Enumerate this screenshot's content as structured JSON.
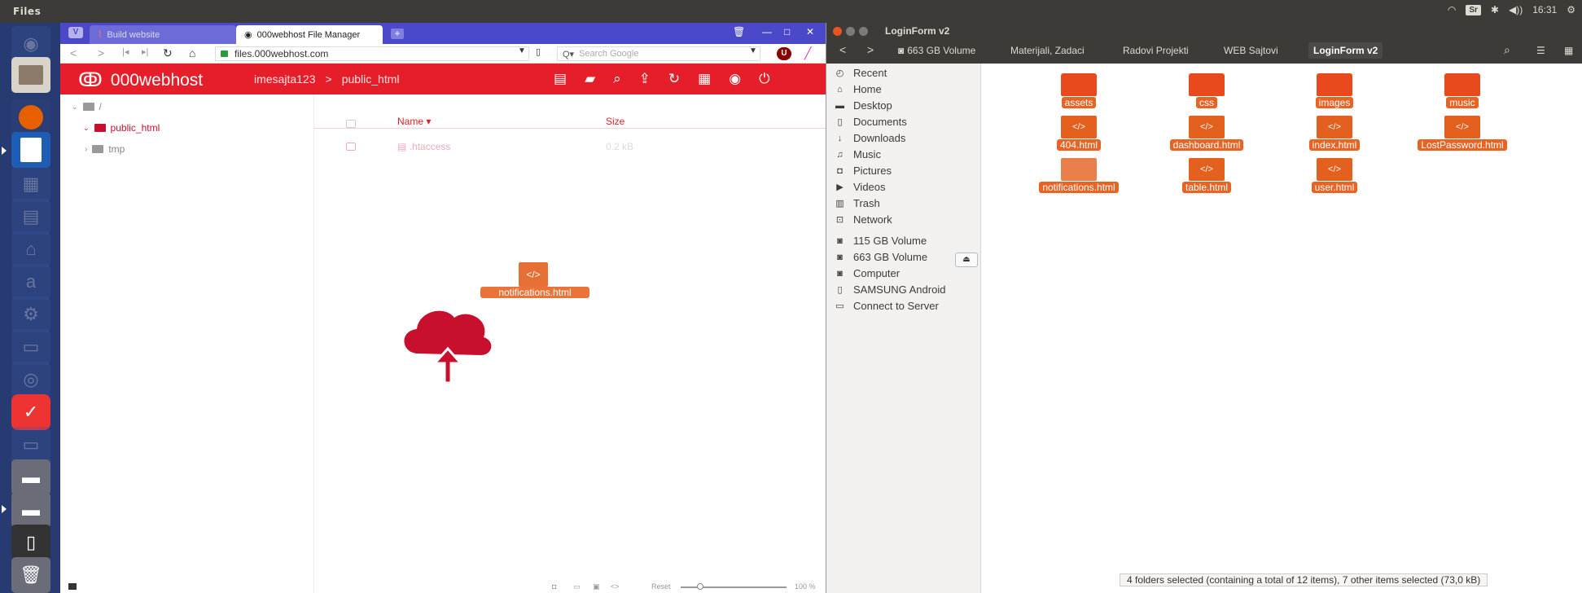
{
  "topbar": {
    "app_name": "Files",
    "time": "16:31",
    "keyboard": "Sr"
  },
  "browser": {
    "tabs": [
      {
        "label": "Build website"
      },
      {
        "label": "000webhost File Manager"
      }
    ],
    "url": "files.000webhost.com",
    "search_placeholder": "Search Google",
    "header": {
      "brand": "000webhost",
      "site": "imesajta123",
      "folder": "public_html"
    },
    "tree": {
      "root": "/",
      "items": [
        {
          "label": "public_html"
        },
        {
          "label": "tmp"
        }
      ]
    },
    "columns": {
      "name": "Name",
      "size": "Size"
    },
    "files": [
      {
        "name": ".htaccess",
        "size": "0.2 kB"
      }
    ],
    "drag_label": "notifications.html",
    "status": {
      "reset": "Reset",
      "zoom": "100 %"
    }
  },
  "files_window": {
    "title": "LoginForm v2",
    "path": [
      "663 GB Volume",
      "Materijali, Zadaci",
      "Radovi Projekti",
      "WEB Sajtovi",
      "LoginForm v2"
    ],
    "sidebar": [
      {
        "label": "Recent",
        "icon": "clock-icon"
      },
      {
        "label": "Home",
        "icon": "home-icon"
      },
      {
        "label": "Desktop",
        "icon": "desktop-icon"
      },
      {
        "label": "Documents",
        "icon": "document-icon"
      },
      {
        "label": "Downloads",
        "icon": "download-icon"
      },
      {
        "label": "Music",
        "icon": "music-icon"
      },
      {
        "label": "Pictures",
        "icon": "camera-icon"
      },
      {
        "label": "Videos",
        "icon": "video-icon"
      },
      {
        "label": "Trash",
        "icon": "trash-icon"
      },
      {
        "label": "Network",
        "icon": "network-icon"
      },
      {
        "label": "115 GB Volume",
        "icon": "drive-icon"
      },
      {
        "label": "663 GB Volume",
        "icon": "drive-icon"
      },
      {
        "label": "Computer",
        "icon": "computer-icon"
      },
      {
        "label": "SAMSUNG Android",
        "icon": "phone-icon"
      },
      {
        "label": "Connect to Server",
        "icon": "server-icon"
      }
    ],
    "items": [
      {
        "name": "assets",
        "kind": "folder"
      },
      {
        "name": "css",
        "kind": "folder"
      },
      {
        "name": "images",
        "kind": "folder"
      },
      {
        "name": "music",
        "kind": "folder"
      },
      {
        "name": "404.html",
        "kind": "html"
      },
      {
        "name": "dashboard.html",
        "kind": "html"
      },
      {
        "name": "index.html",
        "kind": "html"
      },
      {
        "name": "LostPassword.html",
        "kind": "html"
      },
      {
        "name": "notifications.html",
        "kind": "html"
      },
      {
        "name": "table.html",
        "kind": "html"
      },
      {
        "name": "user.html",
        "kind": "html"
      }
    ],
    "status": "4 folders selected (containing a total of 12 items), 7 other items selected (73,0 kB)"
  },
  "colors": {
    "accent": "#e61e29",
    "selection": "#e86424",
    "launcher": "#273a72",
    "tabbar": "#4b49c9"
  }
}
